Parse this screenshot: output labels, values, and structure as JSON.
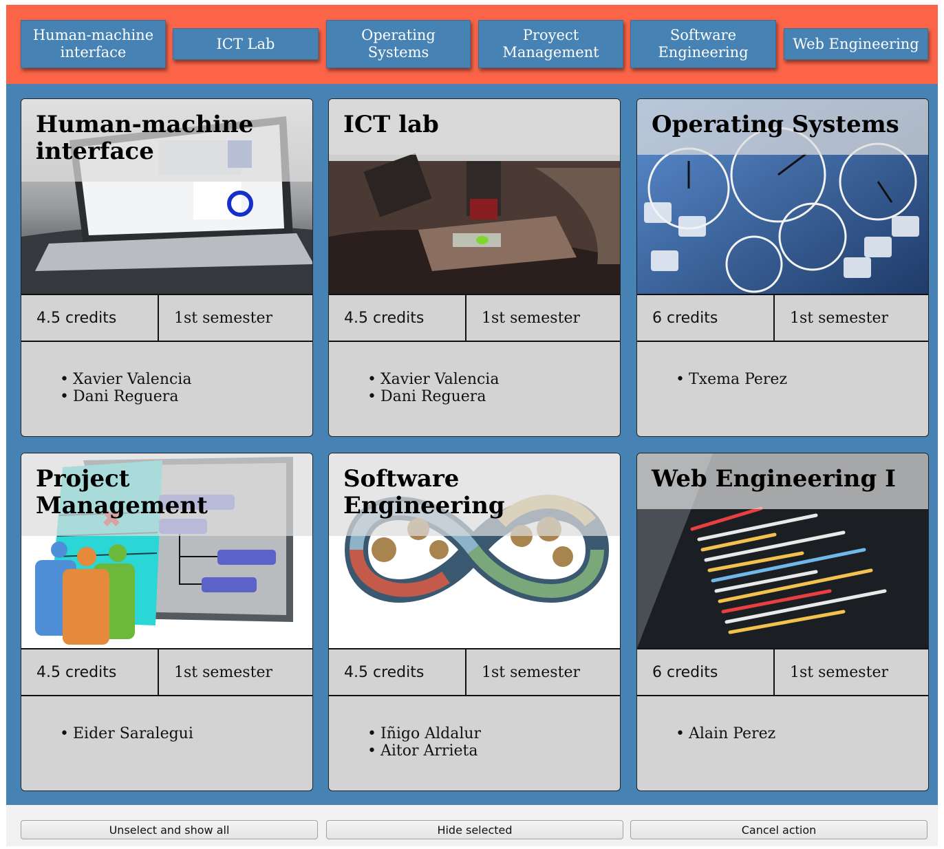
{
  "nav": {
    "items": [
      {
        "label": "Human-machine\ninterface"
      },
      {
        "label": "ICT Lab"
      },
      {
        "label": "Operating\nSystems"
      },
      {
        "label": "Proyect\nManagement"
      },
      {
        "label": "Software\nEngineering"
      },
      {
        "label": "Web Engineering"
      }
    ]
  },
  "courses": [
    {
      "title": "Human-machine interface",
      "credits": "4.5 credits",
      "semester": "1st semester",
      "teachers": [
        "Xavier Valencia",
        "Dani Reguera"
      ]
    },
    {
      "title": "ICT lab",
      "credits": "4.5 credits",
      "semester": "1st semester",
      "teachers": [
        "Xavier Valencia",
        "Dani Reguera"
      ]
    },
    {
      "title": "Operating Systems",
      "credits": "6 credits",
      "semester": "1st semester",
      "teachers": [
        "Txema Perez"
      ]
    },
    {
      "title": "Project Management",
      "credits": "4.5 credits",
      "semester": "1st semester",
      "teachers": [
        "Eider Saralegui"
      ]
    },
    {
      "title": "Software Engineering",
      "credits": "4.5 credits",
      "semester": "1st semester",
      "teachers": [
        "Iñigo Aldalur",
        "Aitor Arrieta"
      ]
    },
    {
      "title": "Web Engineering I",
      "credits": "6 credits",
      "semester": "1st semester",
      "teachers": [
        "Alain Perez"
      ]
    }
  ],
  "footer": {
    "unselect_label": "Unselect and show all",
    "hide_label": "Hide selected",
    "cancel_label": "Cancel action"
  },
  "colors": {
    "nav_bg": "#fb6447",
    "accent": "#4682b4",
    "card_bg": "#d3d3d3"
  },
  "icons": [
    "laptop-photo",
    "microscope-photo",
    "stopwatch-keyboard-photo",
    "gantt-team-illustration",
    "devops-infinity-illustration",
    "code-screen-photo"
  ]
}
